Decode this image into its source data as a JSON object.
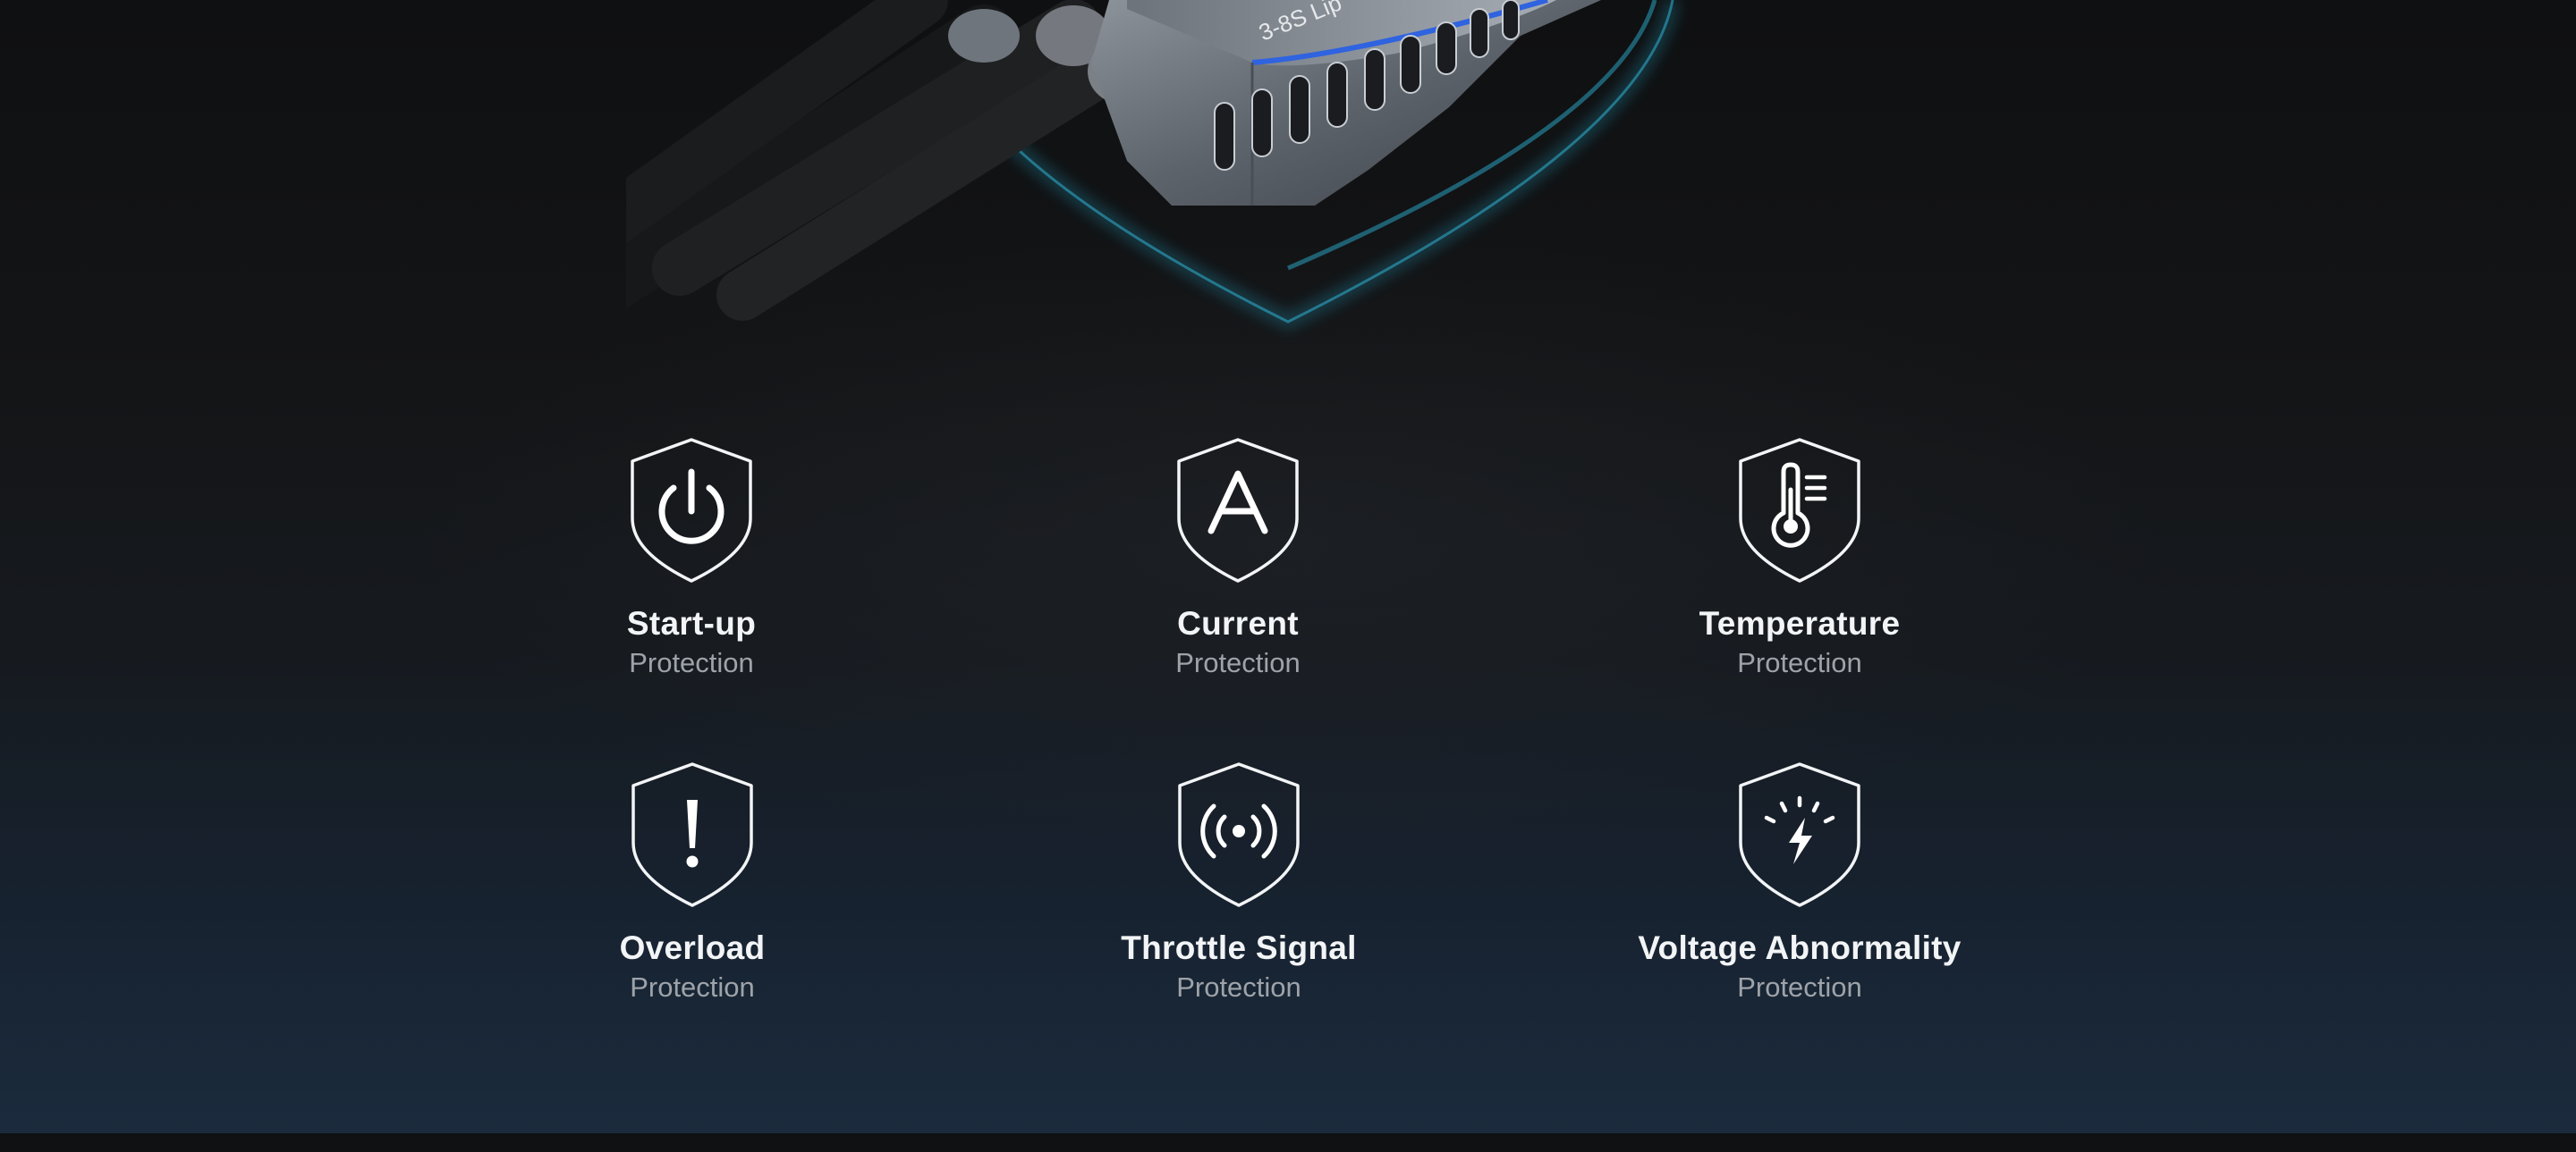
{
  "product": {
    "label": "3-8S Lip",
    "glow_color": "#2fa6c4",
    "accent_color": "#2f63e0"
  },
  "features": [
    {
      "icon": "power-icon",
      "title": "Start-up",
      "subtitle": "Protection"
    },
    {
      "icon": "ampere-icon",
      "title": "Current",
      "subtitle": "Protection"
    },
    {
      "icon": "thermometer-icon",
      "title": "Temperature",
      "subtitle": "Protection"
    },
    {
      "icon": "exclamation-icon",
      "title": "Overload",
      "subtitle": "Protection"
    },
    {
      "icon": "signal-icon",
      "title": "Throttle Signal",
      "subtitle": "Protection"
    },
    {
      "icon": "lightning-icon",
      "title": "Voltage Abnormality",
      "subtitle": "Protection"
    }
  ]
}
